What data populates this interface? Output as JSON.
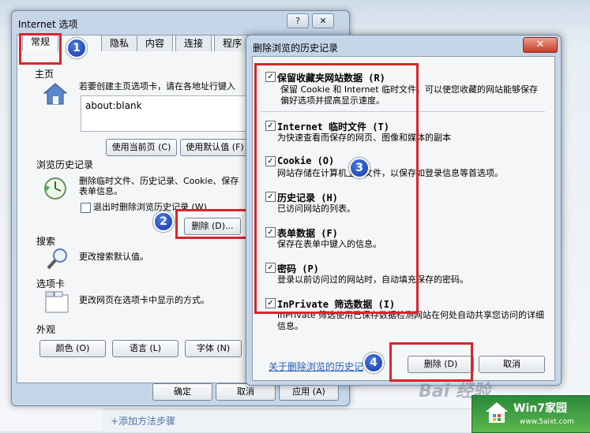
{
  "background": {
    "bottom_link": "+添加方法步骤"
  },
  "ie_dialog": {
    "title": "Internet 选项",
    "help_button": "?",
    "close_button": "✕",
    "tabs": [
      "常规",
      "隐私",
      "内容",
      "连接",
      "程序"
    ],
    "homepage": {
      "label": "主页",
      "desc": "若要创建主页选项卡，请在各地址行键入",
      "url": "about:blank",
      "use_current": "使用当前页 (C)",
      "use_default": "使用默认值 (F)"
    },
    "history": {
      "label": "浏览历史记录",
      "desc_line1": "删除临时文件、历史记录、Cookie、保存",
      "desc_line2": "表单信息。",
      "checkbox_label": "退出时删除浏览历史记录 (W)",
      "delete_button": "删除 (D)..."
    },
    "search": {
      "label": "搜索",
      "desc": "更改搜索默认值。"
    },
    "tabs_section": {
      "label": "选项卡",
      "desc": "更改网页在选项卡中显示的方式。"
    },
    "appearance": {
      "label": "外观",
      "colors": "颜色 (O)",
      "languages": "语言 (L)",
      "fonts": "字体 (N)"
    },
    "footer": {
      "ok": "确定",
      "cancel": "取消",
      "apply": "应用 (A)"
    }
  },
  "delete_dialog": {
    "title": "删除浏览的历史记录",
    "close_button": "✕",
    "items": [
      {
        "title": "保留收藏夹网站数据 (R)",
        "desc": "保留 Cookie 和 Internet 临时文件，可以使您收藏的网站能够保存偏好选项并提高显示速度。",
        "checked": true
      },
      {
        "title": "Internet 临时文件 (T)",
        "desc": "为快速查看而保存的网页、图像和媒体的副本",
        "checked": true
      },
      {
        "title": "Cookie (O)",
        "desc": "网站存储在计算机上的文件，以保存如登录信息等首选项。",
        "checked": true
      },
      {
        "title": "历史记录 (H)",
        "desc": "已访问网站的列表。",
        "checked": true
      },
      {
        "title": "表单数据 (F)",
        "desc": "保存在表单中键入的信息。",
        "checked": true
      },
      {
        "title": "密码 (P)",
        "desc": "登录以前访问过的网站时，自动填充保存的密码。",
        "checked": true
      },
      {
        "title": "InPrivate 筛选数据 (I)",
        "desc": "InPrivate 筛选使用已保存数据检测网站在何处自动共享您访问的详细信息。",
        "checked": true
      }
    ],
    "about_link": "关于删除浏览的历史记",
    "delete_button": "删除 (D)",
    "cancel_button": "取消"
  },
  "annotations": {
    "step1": "1",
    "step2": "2",
    "step3": "3",
    "step4": "4",
    "accent": "#d9252b"
  },
  "watermark": {
    "main": "Win7家园",
    "sub": "www.5aixt.com",
    "baidu": "Bai 经验"
  }
}
